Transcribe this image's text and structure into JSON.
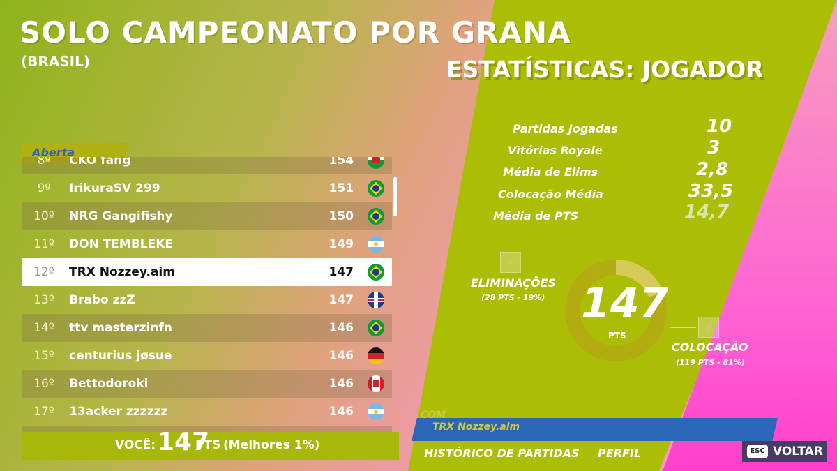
{
  "header": {
    "title": "SOLO CAMPEONATO POR GRANA",
    "region": "(BRASIL)",
    "division_tag": "Aberta"
  },
  "leaderboard": {
    "rows": [
      {
        "rank": "8º",
        "name": "CKO fang",
        "points": "154",
        "flag": "wl"
      },
      {
        "rank": "9º",
        "name": "IrikuraSV 299",
        "points": "151",
        "flag": "br"
      },
      {
        "rank": "10º",
        "name": "NRG Gangifishy",
        "points": "150",
        "flag": "br"
      },
      {
        "rank": "11º",
        "name": "DON TEMBLEKE",
        "points": "149",
        "flag": "ar"
      },
      {
        "rank": "12º",
        "name": "TRX Nozzey.aim",
        "points": "147",
        "flag": "br",
        "highlight": true
      },
      {
        "rank": "13º",
        "name": "Brabo zzZ",
        "points": "147",
        "flag": "gb"
      },
      {
        "rank": "14º",
        "name": "ttv masterzinfn",
        "points": "146",
        "flag": "br"
      },
      {
        "rank": "15º",
        "name": "centurius jøsue",
        "points": "146",
        "flag": "de"
      },
      {
        "rank": "16º",
        "name": "Bettodoroki",
        "points": "146",
        "flag": "ca"
      },
      {
        "rank": "17º",
        "name": "13acker zzzzzz",
        "points": "146",
        "flag": "ar"
      }
    ]
  },
  "you": {
    "label": "VOCÊ:",
    "points": "147",
    "unit": "PTS",
    "best": "(Melhores 1%)"
  },
  "stats": {
    "title": "ESTATÍSTICAS: JOGADOR",
    "items": [
      {
        "label": "Partidas Jogadas",
        "value": "10"
      },
      {
        "label": "Vitórias Royale",
        "value": "3"
      },
      {
        "label": "Média de Elims",
        "value": "2,8"
      },
      {
        "label": "Colocação Média",
        "value": "33,5"
      },
      {
        "label": "Média de PTS",
        "value": "14,7"
      }
    ]
  },
  "breakdown": {
    "total": "147",
    "unit": "PTS",
    "eliminations_label": "ELIMINAÇÕES",
    "eliminations_detail": "(28 PTS - 19%)",
    "eliminations_share": 0.19,
    "placement_label": "COLOCAÇÃO",
    "placement_detail": "(119 PTS - 81%)",
    "placement_share": 0.81
  },
  "player_bar": {
    "with_label": "COM",
    "name": "TRX Nozzey.aim"
  },
  "tabs": {
    "history": "HISTÓRICO DE PARTIDAS",
    "profile": "PERFIL"
  },
  "back": {
    "key": "ESC",
    "label": "VOLTAR"
  }
}
